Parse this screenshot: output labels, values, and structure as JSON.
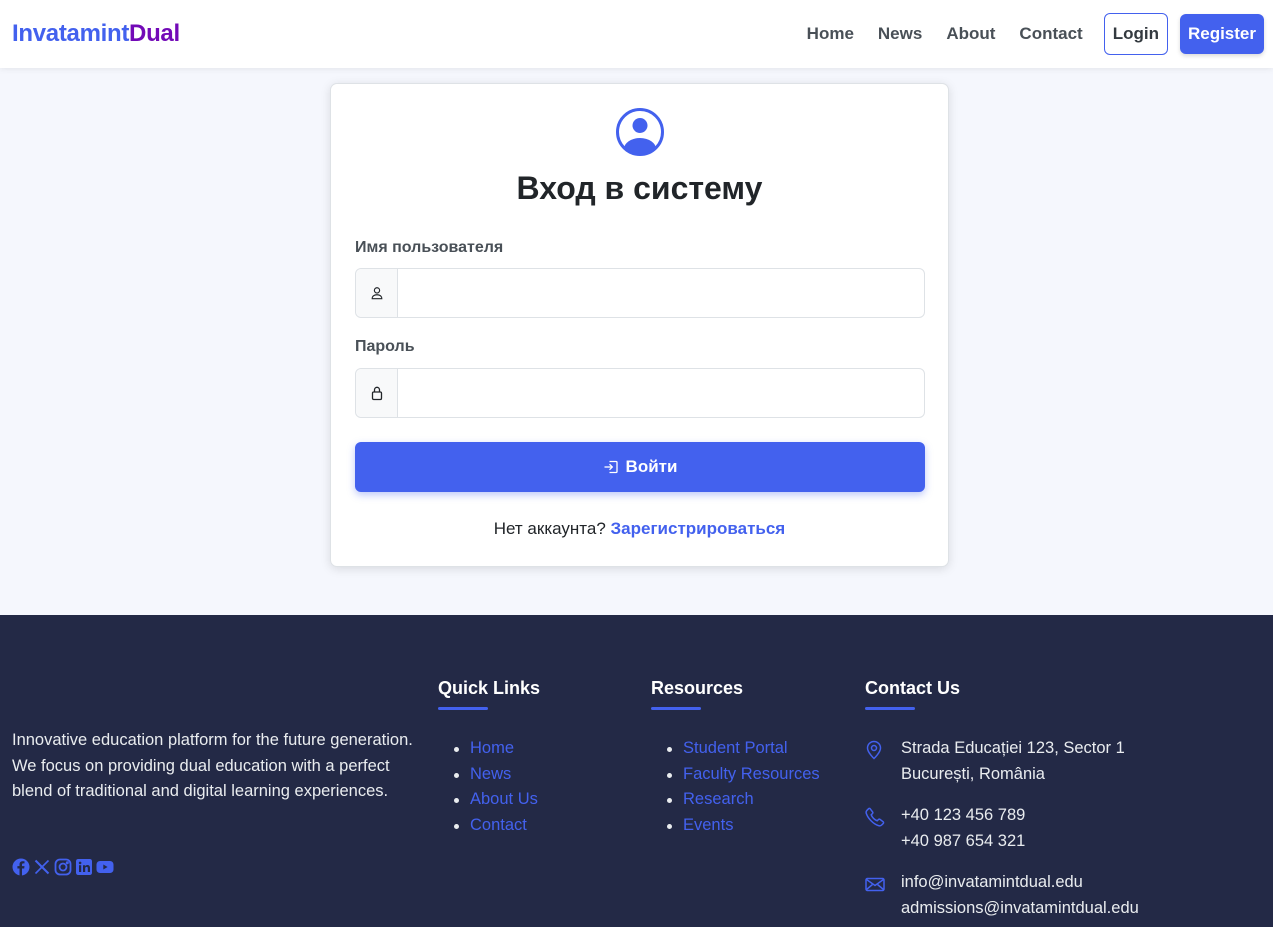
{
  "navbar": {
    "brand_part1": "Invatamint",
    "brand_part2": "Dual",
    "links": [
      "Home",
      "News",
      "About",
      "Contact"
    ],
    "login_label": "Login",
    "register_label": "Register"
  },
  "login": {
    "title": "Вход в систему",
    "username_label": "Имя пользователя",
    "username_value": "",
    "password_label": "Пароль",
    "password_value": "",
    "submit_label": "Войти",
    "no_account_text": "Нет аккаунта?",
    "register_link": "Зарегистрироваться"
  },
  "footer": {
    "about_text": "Innovative education platform for the future generation. We focus on providing dual education with a perfect blend of traditional and digital learning experiences.",
    "social_icons": [
      "facebook-icon",
      "x-twitter-icon",
      "instagram-icon",
      "linkedin-icon",
      "youtube-icon"
    ],
    "quick_links": {
      "title": "Quick Links",
      "items": [
        "Home",
        "News",
        "About Us",
        "Contact"
      ]
    },
    "resources": {
      "title": "Resources",
      "items": [
        "Student Portal",
        "Faculty Resources",
        "Research",
        "Events"
      ]
    },
    "contact": {
      "title": "Contact Us",
      "address_line1": "Strada Educației 123, Sector 1",
      "address_line2": "București, România",
      "phone1": "+40 123 456 789",
      "phone2": "+40 987 654 321",
      "email1": "info@invatamintdual.edu",
      "email2": "admissions@invatamintdual.edu"
    }
  },
  "colors": {
    "primary": "#4361ee",
    "brand_accent": "#7209b7",
    "footer_bg": "#232946",
    "page_bg": "#f5f7fd"
  }
}
